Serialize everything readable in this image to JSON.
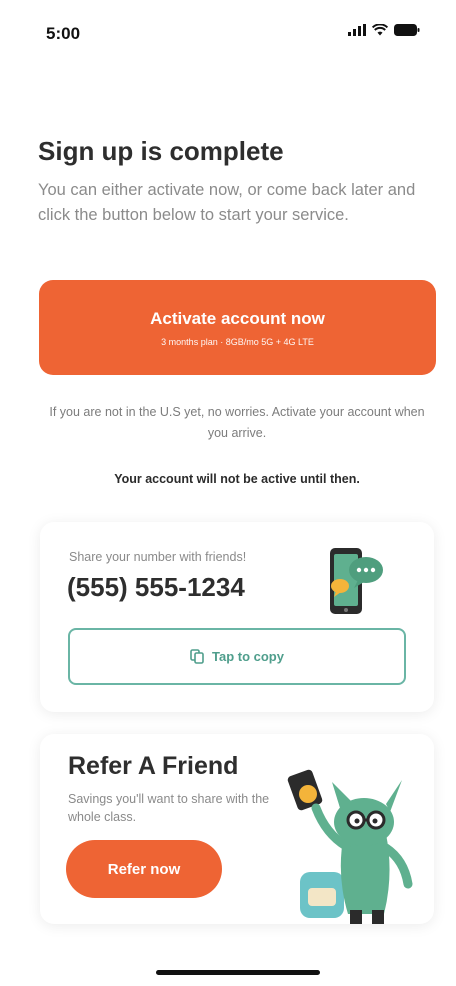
{
  "status_bar": {
    "time": "5:00"
  },
  "header": {
    "title": "Sign up is complete",
    "subtitle": "You can either activate now, or come back later and click the button below to start your service."
  },
  "activate": {
    "label": "Activate account now",
    "plan": "3 months plan · 8GB/mo 5G + 4G LTE"
  },
  "notice": "If you are not in the U.S yet, no worries. Activate your account when you arrive.",
  "warning": "Your account will not be active until then.",
  "share": {
    "label": "Share your number with friends!",
    "number": "(555) 555-1234",
    "copy_label": "Tap to copy"
  },
  "refer": {
    "title": "Refer A Friend",
    "subtitle": "Savings you'll want to share with the whole class.",
    "button_label": "Refer now"
  },
  "colors": {
    "accent": "#ee6434",
    "teal": "#6ab5a5",
    "mascot_green": "#5fb08f"
  },
  "icons": [
    "signal-icon",
    "wifi-icon",
    "battery-icon",
    "copy-icon",
    "phone-chat-illustration",
    "mascot-illustration"
  ]
}
